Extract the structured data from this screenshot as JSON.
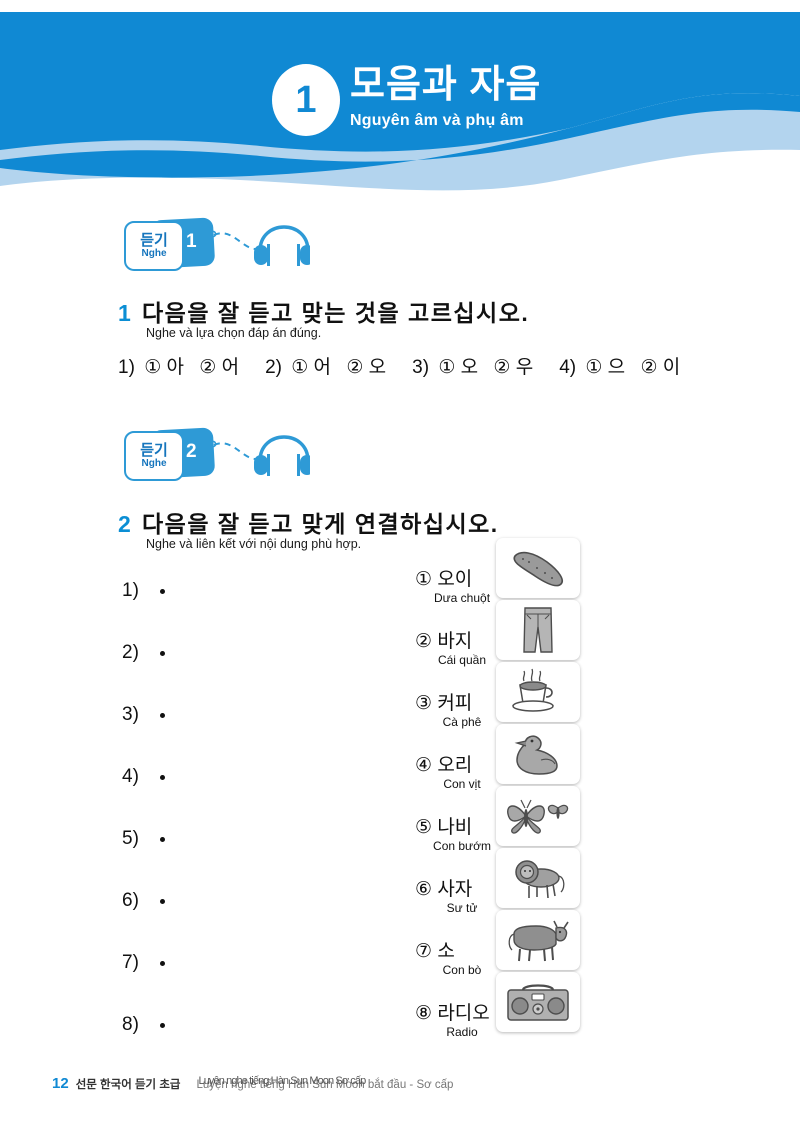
{
  "header": {
    "chapter_number": "1",
    "title_ko": "모음과 자음",
    "title_vi": "Nguyên âm và phụ âm",
    "color_main": "#1089d3",
    "color_wave": "#b3d4ee"
  },
  "audio_badges": [
    {
      "label_ko": "듣기",
      "label_vi": "Nghe",
      "track": "1"
    },
    {
      "label_ko": "듣기",
      "label_vi": "Nghe",
      "track": "2"
    }
  ],
  "questions": [
    {
      "number": "1",
      "prompt_ko": "다음을 잘 듣고 맞는 것을 고르십시오.",
      "prompt_vi": "Nghe và lựa chọn đáp án đúng."
    },
    {
      "number": "2",
      "prompt_ko": "다음을 잘 듣고 맞게 연결하십시오.",
      "prompt_vi": "Nghe và liên kết với nội dung phù hợp."
    }
  ],
  "q1_options": [
    {
      "label": "1)",
      "choices": [
        "① 아",
        "② 어"
      ]
    },
    {
      "label": "2)",
      "choices": [
        "① 어",
        "② 오"
      ]
    },
    {
      "label": "3)",
      "choices": [
        "① 오",
        "② 우"
      ]
    },
    {
      "label": "4)",
      "choices": [
        "① 으",
        "② 이"
      ]
    }
  ],
  "q2_left": [
    {
      "label": "1)"
    },
    {
      "label": "2)"
    },
    {
      "label": "3)"
    },
    {
      "label": "4)"
    },
    {
      "label": "5)"
    },
    {
      "label": "6)"
    },
    {
      "label": "7)"
    },
    {
      "label": "8)"
    }
  ],
  "q2_right": [
    {
      "marker": "①",
      "word_ko": "오이",
      "word_vi": "Dưa chuột",
      "image": "cucumber-illustration"
    },
    {
      "marker": "②",
      "word_ko": "바지",
      "word_vi": "Cái quần",
      "image": "trousers-illustration"
    },
    {
      "marker": "③",
      "word_ko": "커피",
      "word_vi": "Cà phê",
      "image": "coffee-cup-illustration"
    },
    {
      "marker": "④",
      "word_ko": "오리",
      "word_vi": "Con vịt",
      "image": "duck-illustration"
    },
    {
      "marker": "⑤",
      "word_ko": "나비",
      "word_vi": "Con bướm",
      "image": "butterfly-illustration"
    },
    {
      "marker": "⑥",
      "word_ko": "사자",
      "word_vi": "Sư tử",
      "image": "lion-illustration"
    },
    {
      "marker": "⑦",
      "word_ko": "소",
      "word_vi": "Con bò",
      "image": "cow-illustration"
    },
    {
      "marker": "⑧",
      "word_ko": "라디오",
      "word_vi": "Radio",
      "image": "radio-illustration"
    }
  ],
  "footer": {
    "page_number": "12",
    "book_title_ko": "선문 한국어 듣기 초급",
    "book_title_vi": "Luyện nghe tiếng Hàn Sun Moon bắt đầu - Sơ cấp",
    "book_title_vi_overlap": "Luyện nghe tiếng Hàn Sun Moon Sơ cấp"
  }
}
